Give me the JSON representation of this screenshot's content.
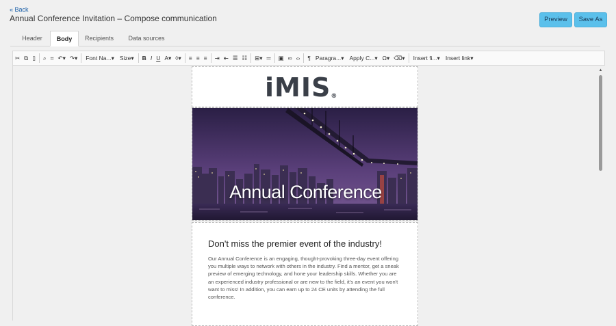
{
  "header": {
    "back_label": "« Back",
    "title": "Annual Conference Invitation – Compose communication",
    "preview_label": "Preview",
    "save_as_label": "Save As"
  },
  "tabs": [
    {
      "label": "Header"
    },
    {
      "label": "Body"
    },
    {
      "label": "Recipients"
    },
    {
      "label": "Data sources"
    }
  ],
  "active_tab": "Body",
  "toolbar": {
    "font_name": "Font Na...",
    "size": "Size",
    "paragraph": "Paragra...",
    "apply_css": "Apply C...",
    "insert_field": "Insert fi...",
    "insert_link": "Insert link"
  },
  "email": {
    "logo_text": "iMIS",
    "hero_title": "Annual Conference",
    "headline": "Don't miss the premier event of the industry!",
    "body": "Our Annual Conference is an engaging, thought-provoking three-day event offering you multiple ways to network with others in the industry. Find a mentor, get a sneak preview of emerging technology, and hone your leadership skills. Whether you are an experienced industry professional or are new to the field, it's an event you won't want to miss! In addition, you can earn up to 24 CE units by attending the full conference."
  },
  "colors": {
    "accent_button": "#5bc0eb",
    "link": "#1a5fa8",
    "logo_dark": "#3a3f48"
  }
}
